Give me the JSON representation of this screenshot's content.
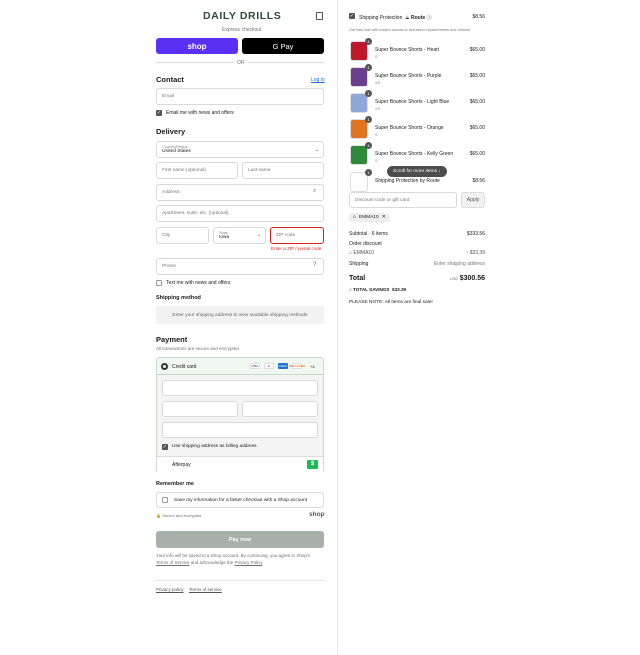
{
  "brand": "DAILY DRILLS",
  "express": {
    "label": "Express checkout",
    "shop_pay": "shop",
    "gpay": "G Pay",
    "or": "OR"
  },
  "contact": {
    "title": "Contact",
    "login": "Log in",
    "email_placeholder": "Email",
    "news_label": "Email me with news and offers"
  },
  "delivery": {
    "title": "Delivery",
    "country_label": "Country/Region",
    "country_value": "United States",
    "first_name": "First name (optional)",
    "last_name": "Last name",
    "address": "Address",
    "apartment": "Apartment, suite, etc. (optional)",
    "city": "City",
    "state_label": "State",
    "state_value": "Iowa",
    "zip": "ZIP code",
    "zip_error": "Enter a ZIP / postal code",
    "phone": "Phone",
    "text_label": "Text me with news and offers"
  },
  "shipping_method": {
    "title": "Shipping method",
    "notice": "Enter your shipping address to view available shipping methods"
  },
  "payment": {
    "title": "Payment",
    "subtitle": "All transactions are secure and encrypted.",
    "credit_card": "Credit card",
    "card_brands": [
      "VISA",
      "MC",
      "AMEX",
      "DISCOVER"
    ],
    "more_brands": "+4",
    "billing_label": "Use shipping address as billing address",
    "afterpay": "Afterpay",
    "afterpay_icon": "$"
  },
  "remember": {
    "title": "Remember me",
    "save_label": "Save my information for a faster checkout with a Shop account",
    "secure": "Secure and encrypted",
    "shop_logo": "shop"
  },
  "pay_now": "Pay now",
  "legal": {
    "line1": "Your info will be saved to a Shop account. By continuing, you agree to Shop's",
    "terms": "Terms of Service",
    "and": "and acknowledge the",
    "privacy": "Privacy Policy",
    "end": "."
  },
  "footer": {
    "privacy": "Privacy policy",
    "terms": "Terms of service"
  },
  "summary": {
    "protection_label": "Shipping Protection",
    "protection_brand": "Route",
    "protection_price": "$8.56",
    "protection_desc": "Get help fast with instant access to self-serve replacements and refunds.",
    "items": [
      {
        "name": "Super Bounce Shorts - Heart",
        "size": "S",
        "price": "$65.00",
        "qty": "1",
        "color": "#c0182a"
      },
      {
        "name": "Super Bounce Shorts - Purple",
        "size": "XS",
        "price": "$65.00",
        "qty": "1",
        "color": "#6b3f8f"
      },
      {
        "name": "Super Bounce Shorts - Light Blue",
        "size": "XS",
        "price": "$65.00",
        "qty": "1",
        "color": "#8fa8d8"
      },
      {
        "name": "Super Bounce Shorts - Orange",
        "size": "S",
        "price": "$65.00",
        "qty": "1",
        "color": "#e0741f"
      },
      {
        "name": "Super Bounce Shorts - Kelly Green",
        "size": "S",
        "price": "$65.00",
        "qty": "1",
        "color": "#2e8a3a"
      },
      {
        "name": "Shipping Protection by Route",
        "size": "",
        "price": "$8.56",
        "qty": "1",
        "color": "#ffffff"
      }
    ],
    "scroll_pill": "Scroll for more items",
    "discount_placeholder": "Discount code or gift card",
    "apply": "Apply",
    "code": "EMMA10",
    "subtotal_label": "Subtotal · 6 items",
    "subtotal": "$333.56",
    "order_discount": "Order discount",
    "code_line": "EMMA10",
    "discount_value": "- $33.39",
    "shipping_label": "Shipping",
    "shipping_value": "Enter shipping address",
    "total_label": "Total",
    "currency": "USD",
    "total": "$300.56",
    "savings_label": "TOTAL SAVINGS",
    "savings": "$33.39",
    "note": "PLEASE NOTE: All items are final sale!"
  }
}
